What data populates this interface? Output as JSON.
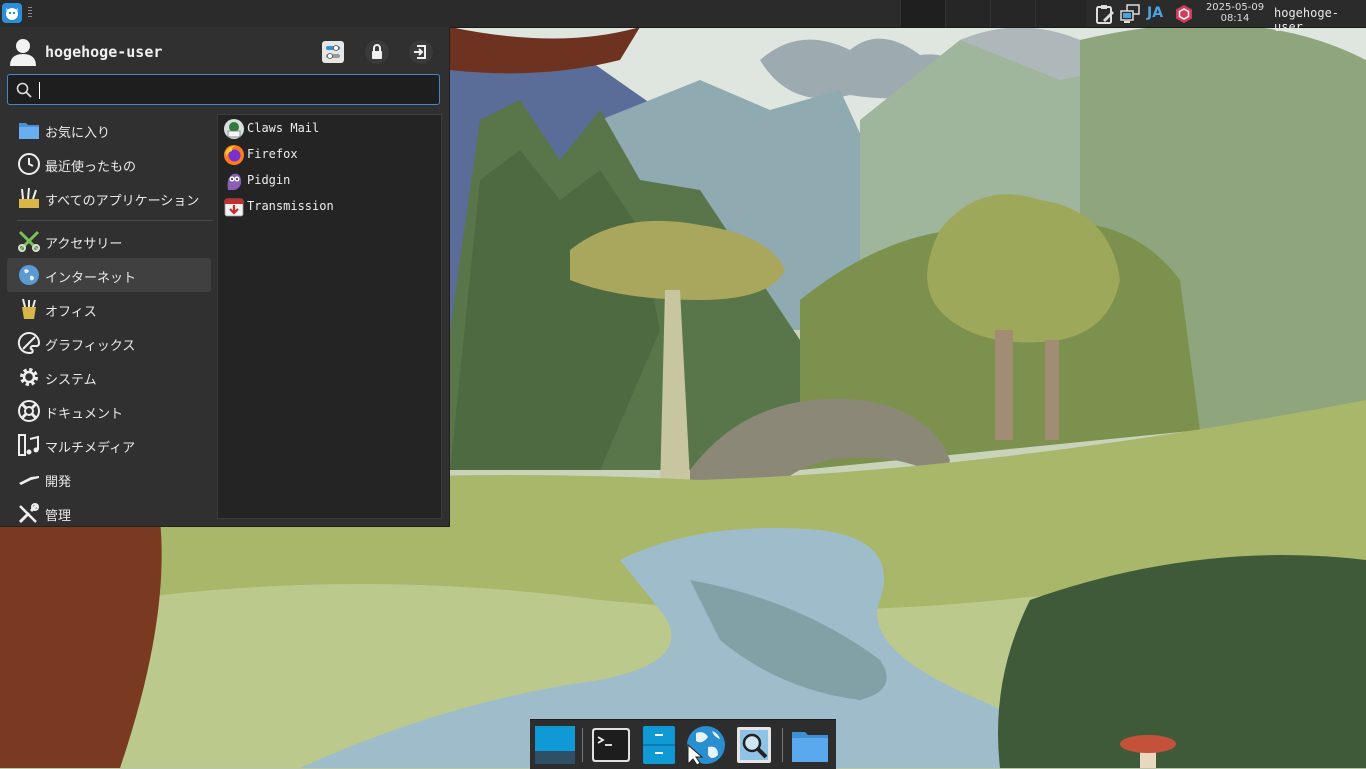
{
  "panel": {
    "whisker_icon": "whisker-menu-icon",
    "ime": "JA",
    "clock": {
      "date": "2025-05-09",
      "time": "08:14"
    },
    "user": "hogehoge-user",
    "tray_icons": [
      "clipboard-icon",
      "network-icon",
      "fcitx-icon"
    ]
  },
  "menu": {
    "username": "hogehoge-user",
    "header_buttons": [
      "settings-icon",
      "lock-icon",
      "logout-icon"
    ],
    "search": {
      "value": "",
      "placeholder": ""
    },
    "categories": [
      {
        "label": "お気に入り",
        "icon": "favorites-icon",
        "active": false
      },
      {
        "label": "最近使ったもの",
        "icon": "recent-icon",
        "active": false
      },
      {
        "label": "すべてのアプリケーション",
        "icon": "all-apps-icon",
        "active": false
      },
      {
        "label": "アクセサリー",
        "icon": "accessories-icon",
        "active": false
      },
      {
        "label": "インターネット",
        "icon": "internet-icon",
        "active": true
      },
      {
        "label": "オフィス",
        "icon": "office-icon",
        "active": false
      },
      {
        "label": "グラフィックス",
        "icon": "graphics-icon",
        "active": false
      },
      {
        "label": "システム",
        "icon": "system-icon",
        "active": false
      },
      {
        "label": "ドキュメント",
        "icon": "help-icon",
        "active": false
      },
      {
        "label": "マルチメディア",
        "icon": "multimedia-icon",
        "active": false
      },
      {
        "label": "開発",
        "icon": "development-icon",
        "active": false
      },
      {
        "label": "管理",
        "icon": "admin-icon",
        "active": false
      }
    ],
    "apps": [
      {
        "label": "Claws Mail",
        "icon": "claws-mail-icon"
      },
      {
        "label": "Firefox",
        "icon": "firefox-icon"
      },
      {
        "label": "Pidgin",
        "icon": "pidgin-icon"
      },
      {
        "label": "Transmission",
        "icon": "transmission-icon"
      }
    ]
  },
  "dock": {
    "items": [
      "show-desktop-icon",
      "terminal-icon",
      "file-manager-icon",
      "web-browser-icon",
      "app-finder-icon",
      "folder-icon"
    ]
  },
  "colors": {
    "accent": "#4a86c5",
    "panel_bg": "#2b2b2b",
    "menu_bg": "#303030"
  }
}
